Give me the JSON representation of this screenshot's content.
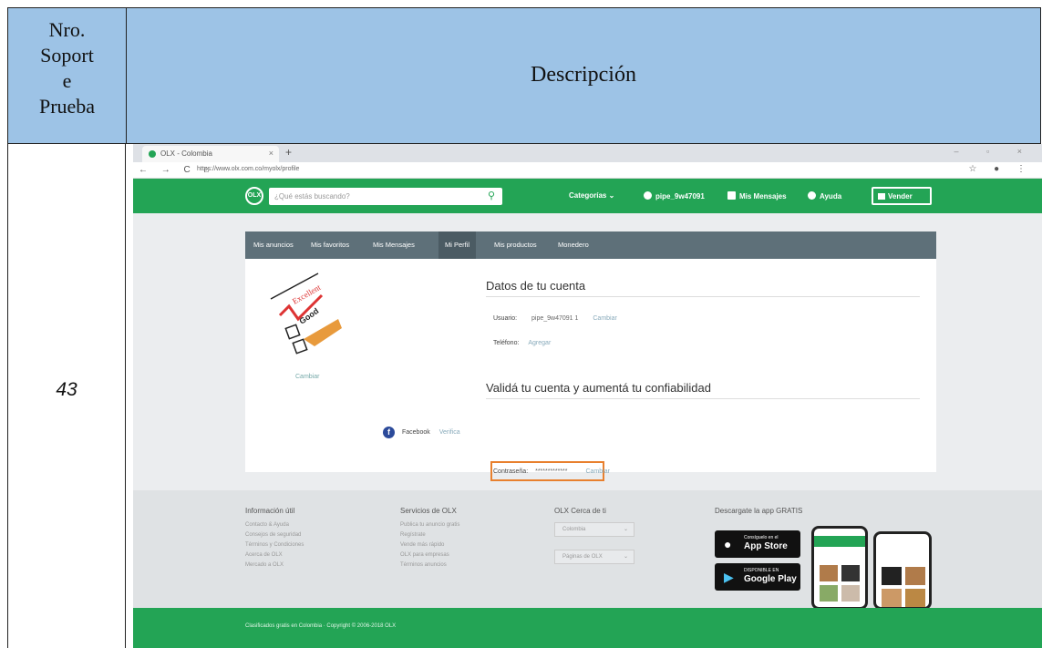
{
  "table": {
    "header_left": [
      "Nro.",
      "Soport",
      "e",
      "Prueba"
    ],
    "header_right": "Descripción",
    "row_number": "43"
  },
  "browser": {
    "tab_title": "OLX - Colombia",
    "tab_close": "×",
    "new_tab": "+",
    "nav_buttons": "← → C ⌂",
    "url": "https://www.olx.com.co/myolx/profile",
    "window_controls": "– ▫ ×",
    "addr_right": "☆ ● ⋮"
  },
  "olx_header": {
    "logo": "OLX",
    "search_placeholder": "¿Qué estás buscando?",
    "categories": "Categorías ⌄",
    "user": "pipe_9w47091",
    "messages": "Mis Mensajes",
    "help": "Ayuda",
    "sell": "Vender"
  },
  "subnav": {
    "items": [
      "Mis anuncios",
      "Mis favoritos",
      "Mis Mensajes",
      "Mi Perfil",
      "Mis productos",
      "Monedero"
    ]
  },
  "profile": {
    "change_photo": "Cambiar",
    "account_title": "Datos de tu cuenta",
    "user_label": "Usuario:",
    "user_value": "pipe_9w47091 1",
    "user_change": "Cambiar",
    "phone_label": "Teléfono:",
    "phone_value": "Agregar",
    "password_label": "Contraseña:",
    "password_value": "*************",
    "password_change": "Cambiar",
    "validate_title": "Validá tu cuenta y aumentá tu confiabilidad",
    "facebook_label": "Facebook",
    "facebook_action": "Verifica"
  },
  "footer": {
    "col1_title": "Información útil",
    "col1_items": [
      "Contacto & Ayuda",
      "Consejos de seguridad",
      "Términos y Condiciones",
      "Acerca de OLX",
      "Mercado a OLX"
    ],
    "col2_title": "Servicios de OLX",
    "col2_items": [
      "Publica tu anuncio gratis",
      "Regístrate",
      "Vende más rápido",
      "OLX para empresas",
      "Términos anuncios"
    ],
    "col3_title": "OLX Cerca de ti",
    "col3_select1": "Colombia",
    "col3_select2": "Páginas de OLX",
    "app_title": "Descargate la app GRATIS",
    "appstore_small": "Consíguelo en el",
    "appstore_big": "App Store",
    "gplay_small": "DISPONIBLE EN",
    "gplay_big": "Google Play",
    "bottom_text": "Clasificados gratis en Colombia · Copyright © 2006-2018 OLX"
  }
}
